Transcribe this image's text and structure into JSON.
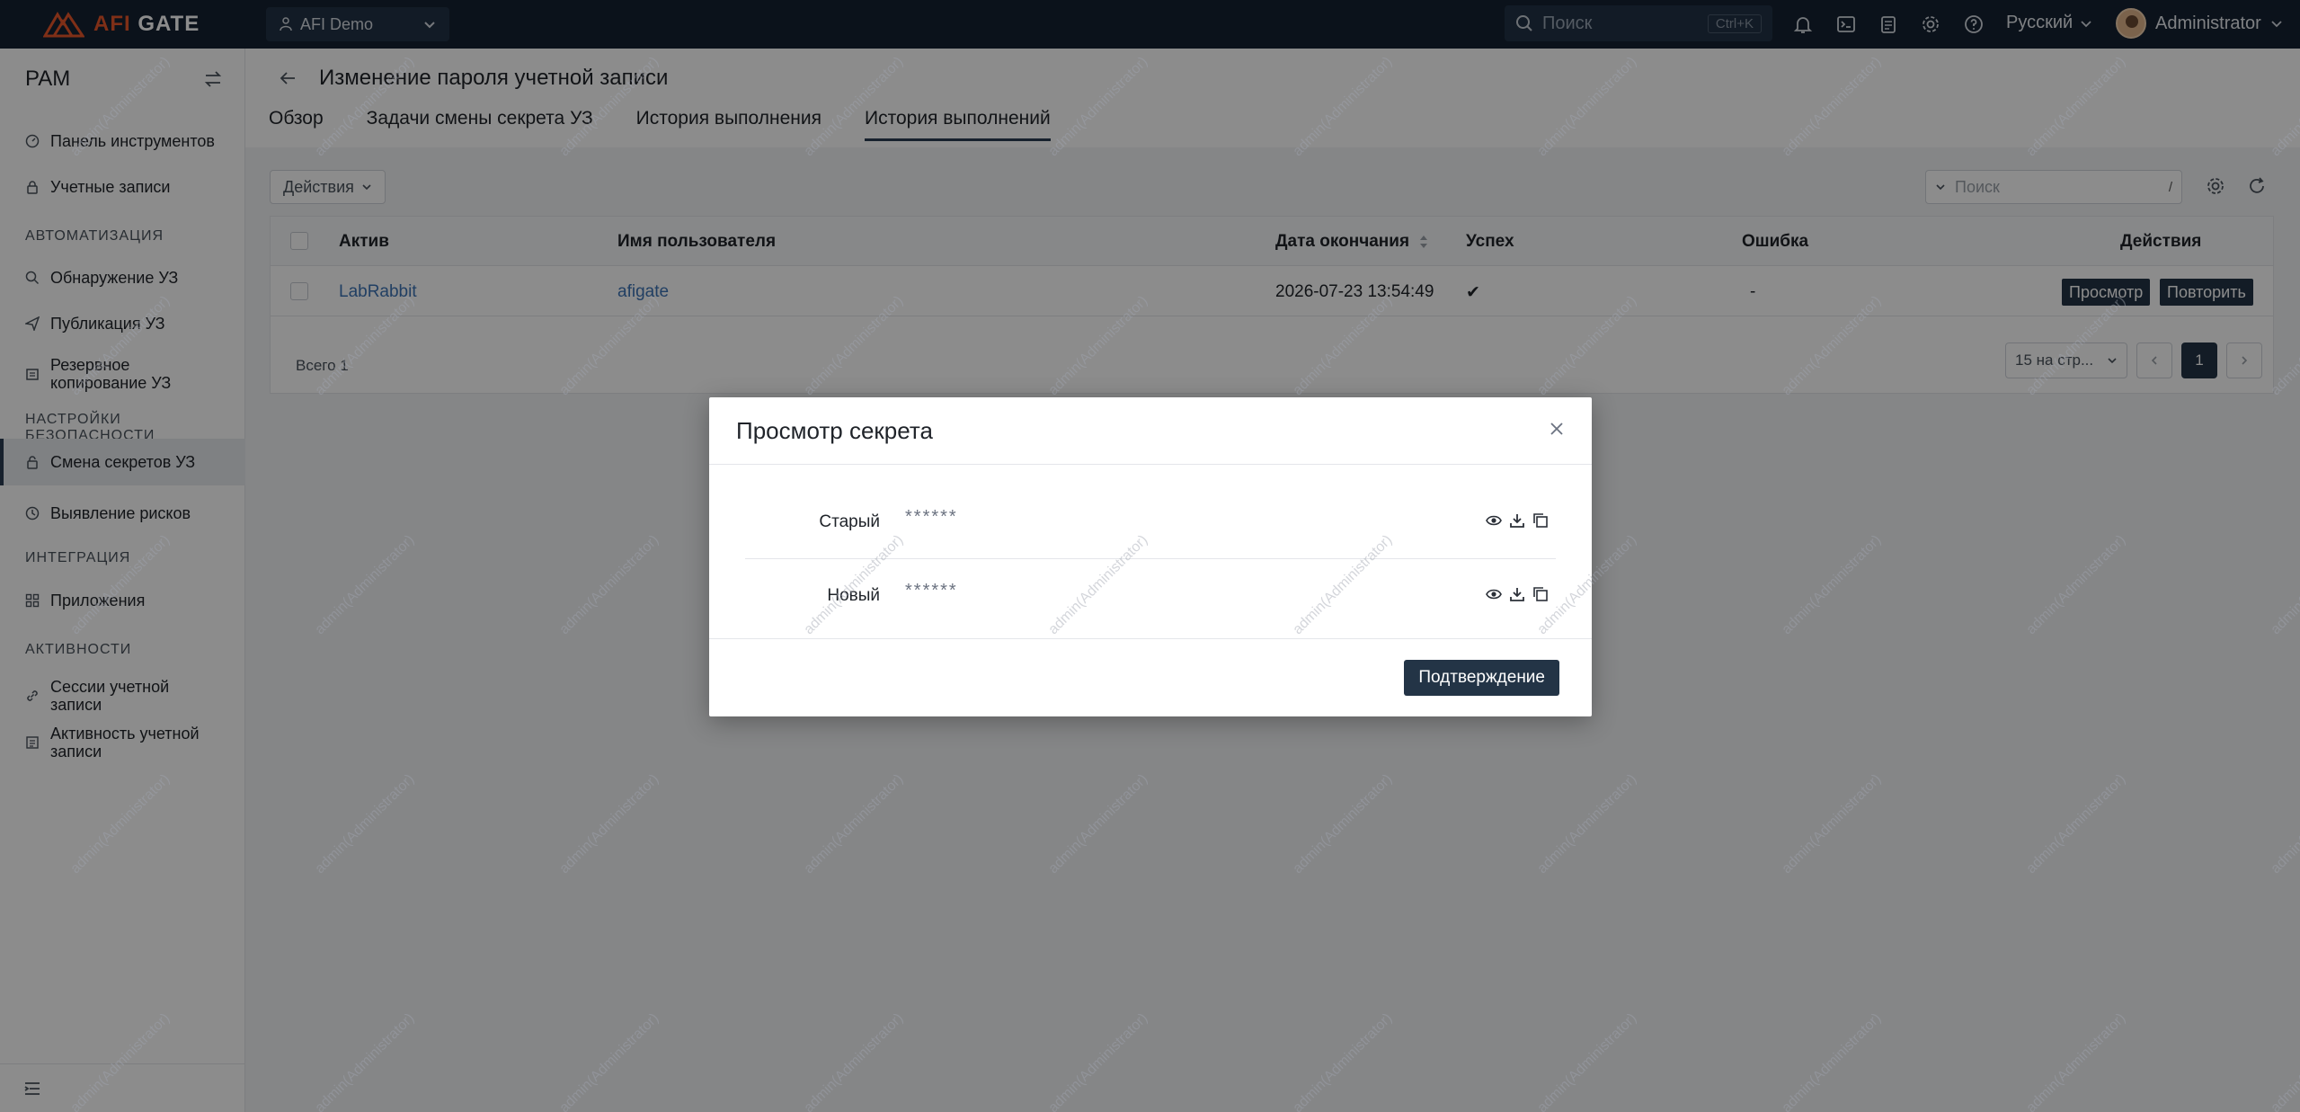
{
  "topbar": {
    "logo": {
      "accent": "AFI",
      "text": " GATE"
    },
    "org": "AFI Demo",
    "search_placeholder": "Поиск",
    "search_shortcut": "Ctrl+K",
    "language": "Русский",
    "user": "Administrator"
  },
  "sidebar": {
    "title": "PAM",
    "items": [
      {
        "label": "Панель инструментов"
      },
      {
        "label": "Учетные записи"
      },
      {
        "label": "Обнаружение УЗ"
      },
      {
        "label": "Публикация УЗ"
      },
      {
        "label": "Резервное копирование УЗ"
      },
      {
        "label": "Смена секретов УЗ"
      },
      {
        "label": "Выявление рисков"
      },
      {
        "label": "Приложения"
      },
      {
        "label": "Сессии учетной записи"
      },
      {
        "label": "Активность учетной записи"
      }
    ],
    "sections": [
      "АВТОМАТИЗАЦИЯ",
      "НАСТРОЙКИ БЕЗОПАСНОСТИ",
      "ИНТЕГРАЦИЯ",
      "АКТИВНОСТИ"
    ]
  },
  "page": {
    "title": "Изменение пароля учетной записи",
    "tabs": [
      "Обзор",
      "Задачи смены секрета УЗ",
      "История выполнения",
      "История выполнений"
    ]
  },
  "toolbar": {
    "actions_label": "Действия",
    "search_placeholder": "Поиск",
    "search_shortcut": "/"
  },
  "table": {
    "headers": [
      "Актив",
      "Имя пользователя",
      "Дата окончания",
      "Успех",
      "Ошибка",
      "Действия"
    ],
    "rows": [
      {
        "asset": "LabRabbit",
        "username": "afigate",
        "date": "2026-07-23 13:54:49",
        "success": "✔",
        "error": "-",
        "btn_view": "Просмотр",
        "btn_retry": "Повторить"
      }
    ],
    "total": "Всего 1",
    "page_size": "15 на стр...",
    "current_page": "1"
  },
  "modal": {
    "title": "Просмотр секрета",
    "rows": [
      {
        "label": "Старый",
        "value": "******"
      },
      {
        "label": "Новый",
        "value": "******"
      }
    ],
    "confirm": "Подтверждение"
  },
  "watermark": "admin(Administrator)"
}
